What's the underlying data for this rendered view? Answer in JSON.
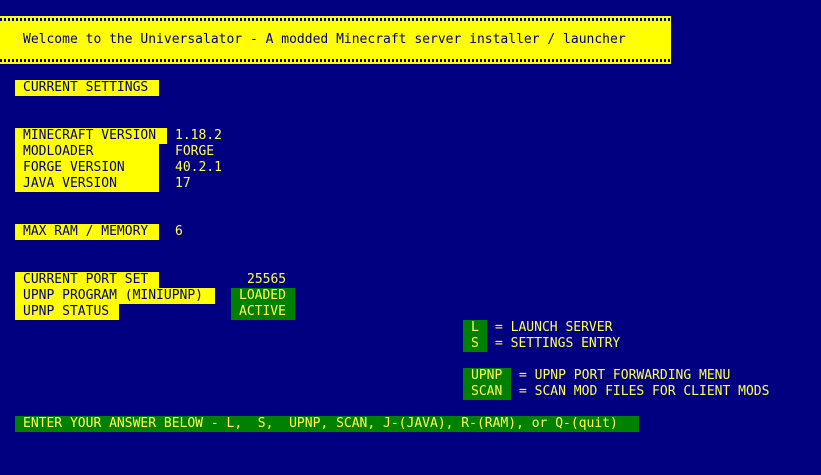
{
  "banner": {
    "title": "Welcome to the Universalator - A modded Minecraft server installer / launcher"
  },
  "current_settings": {
    "heading": "CURRENT SETTINGS",
    "minecraft_version_label": "MINECRAFT VERSION",
    "minecraft_version_value": "1.18.2",
    "modloader_label": "MODLOADER",
    "modloader_value": "FORGE",
    "forge_version_label": "FORGE VERSION",
    "forge_version_value": "40.2.1",
    "java_version_label": "JAVA VERSION",
    "java_version_value": "17"
  },
  "memory": {
    "label": "MAX RAM / MEMORY",
    "value": "6"
  },
  "network": {
    "port_label": "CURRENT PORT SET",
    "port_value": "25565",
    "upnp_program_label": "UPNP PROGRAM (MINIUPNP)",
    "upnp_program_value": "LOADED",
    "upnp_status_label": "UPNP STATUS",
    "upnp_status_value": "ACTIVE"
  },
  "menu": {
    "items": [
      {
        "key": "L",
        "text": "= LAUNCH SERVER"
      },
      {
        "key": "S",
        "text": "= SETTINGS ENTRY"
      },
      {
        "key": "UPNP",
        "text": "= UPNP PORT FORWARDING MENU"
      },
      {
        "key": "SCAN",
        "text": "= SCAN MOD FILES FOR CLIENT MODS"
      }
    ]
  },
  "prompt": {
    "text": "ENTER YOUR ANSWER BELOW - L,  S,  UPNP, SCAN, J-(JAVA), R-(RAM), or Q-(quit)"
  },
  "colors": {
    "background": "#000080",
    "highlight_yellow": "#ffff00",
    "highlight_green": "#008000",
    "text_yellow": "#ffff55"
  }
}
